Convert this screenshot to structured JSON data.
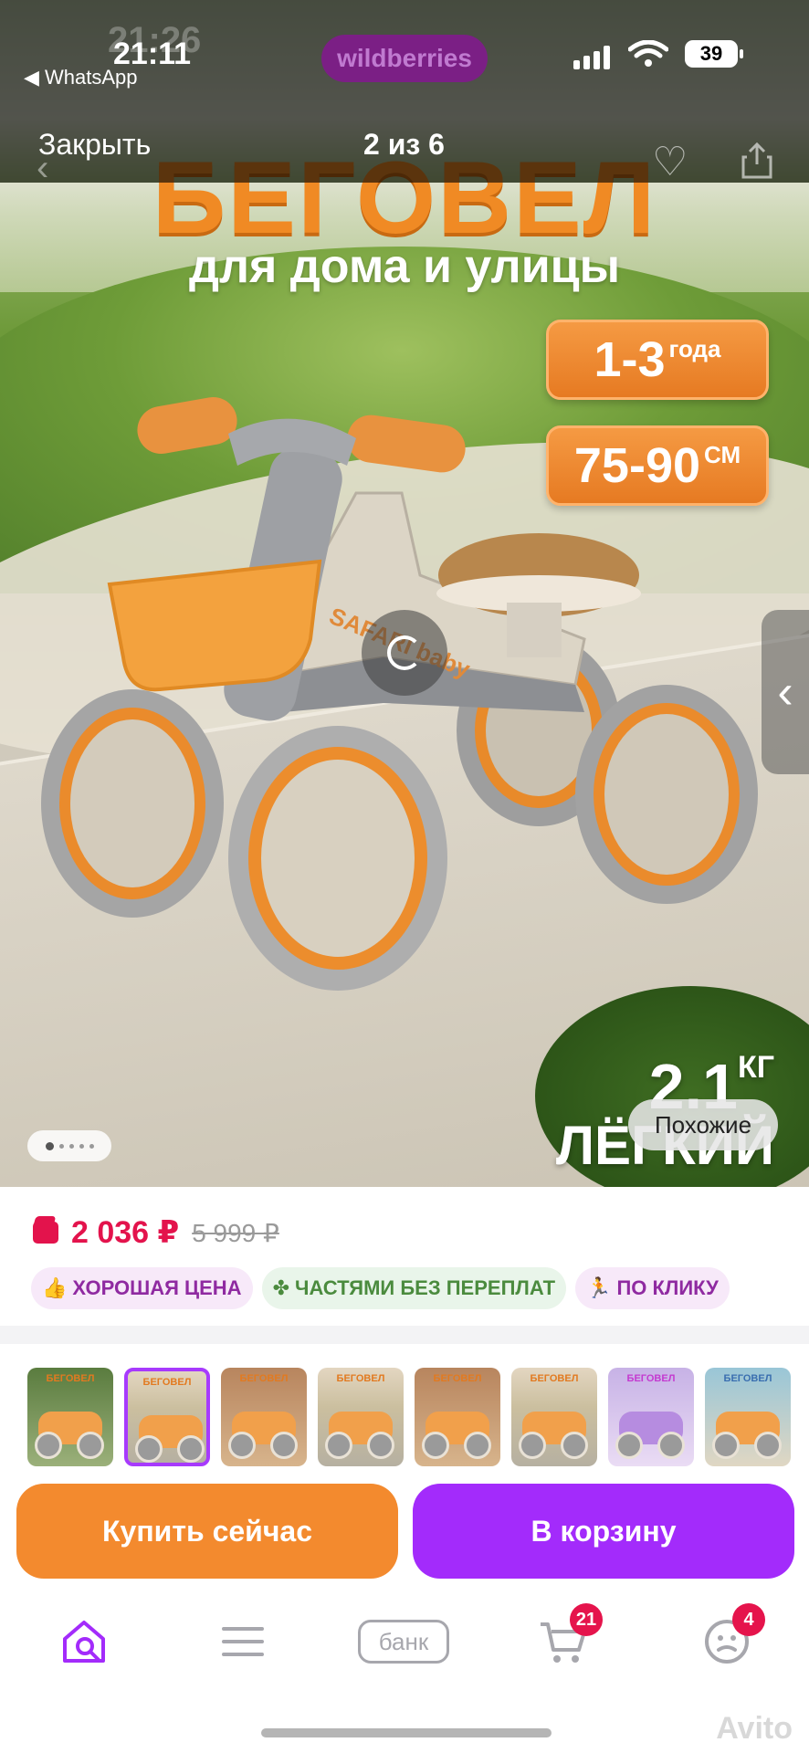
{
  "status_bar": {
    "time": "21:11",
    "time_ghost": "21:26",
    "back_app": "◀ WhatsApp",
    "center_app": "wildberries",
    "battery": "39"
  },
  "viewer": {
    "close_label": "Закрыть",
    "counter": "2 из 6"
  },
  "hero": {
    "title": "БЕГОВЕЛ",
    "subtitle": "для дома и улицы",
    "age_value": "1-3",
    "age_unit": "года",
    "height_value": "75-90",
    "height_unit": "СМ",
    "weight_value": "2.1",
    "weight_unit": "КГ",
    "weight_caption": "ЛЁГКИЙ",
    "similar_label": "Похожие",
    "brand_on_bike": "SAFARI baby"
  },
  "product": {
    "price": "2 036 ₽",
    "old_price": "5 999 ₽",
    "tags": [
      {
        "label": "ХОРОШАЯ ЦЕНА",
        "icon": "thumbs-up-icon"
      },
      {
        "label": "ЧАСТЯМИ БЕЗ ПЕРЕПЛАТ",
        "icon": "clover-icon"
      },
      {
        "label": "ПО КЛИКУ",
        "icon": "running-person-icon"
      }
    ],
    "thumbnail_titles": [
      "БЕГОВЕЛ",
      "БЕГОВЕЛ",
      "БЕГОВЕЛ",
      "БЕГОВЕЛ",
      "БЕГОВЕЛ",
      "БЕГОВЕЛ",
      "БЕГОВЕЛ",
      "БЕГОВЕЛ"
    ]
  },
  "actions": {
    "buy_now": "Купить сейчас",
    "add_to_cart": "В корзину"
  },
  "tabbar": {
    "bank_label": "банк",
    "cart_badge": "21",
    "profile_badge": "4"
  },
  "watermark": "Avito",
  "colors": {
    "accent_orange": "#f38a2e",
    "accent_purple": "#a32bfb",
    "price_red": "#e3134c"
  }
}
